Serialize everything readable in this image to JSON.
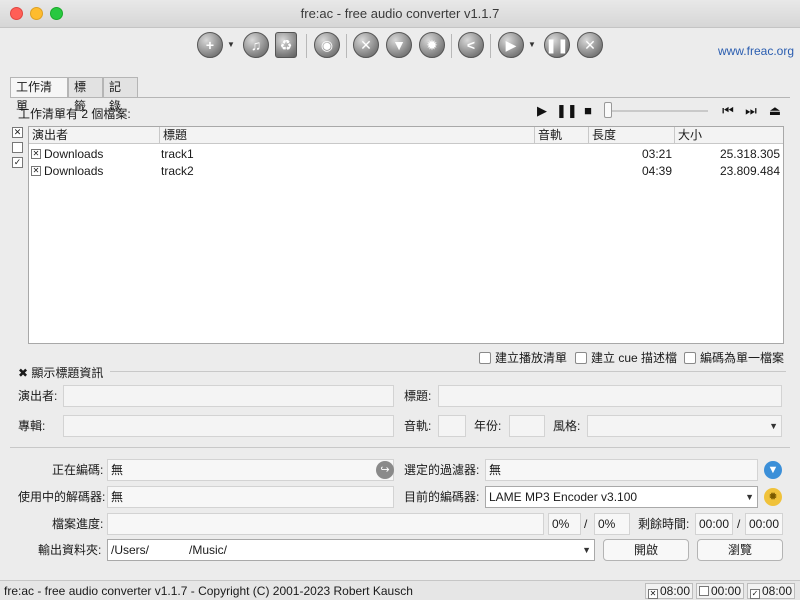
{
  "window": {
    "title": "fre:ac - free audio converter v1.1.7"
  },
  "toolbar": {
    "website": "www.freac.org"
  },
  "tabs": [
    "工作清單",
    "標籤",
    "記錄"
  ],
  "joblist": {
    "count_text": "工作清單有 2 個檔案:",
    "columns": {
      "artist": "演出者",
      "title": "標題",
      "track": "音軌",
      "length": "長度",
      "size": "大小"
    },
    "rows": [
      {
        "artist": "Downloads",
        "title": "track1",
        "length": "03:21",
        "size": "25.318.305"
      },
      {
        "artist": "Downloads",
        "title": "track2",
        "length": "04:39",
        "size": "23.809.484"
      }
    ]
  },
  "options": {
    "playlist": "建立播放清單",
    "cue": "建立 cue 描述檔",
    "single_file": "編碼為單一檔案"
  },
  "tag_info": {
    "section": "顯示標題資訊",
    "artist_label": "演出者:",
    "title_label": "標題:",
    "album_label": "專輯:",
    "track_label": "音軌:",
    "year_label": "年份:",
    "genre_label": "風格:"
  },
  "status_panel": {
    "encoding_label": "正在編碼:",
    "encoding_value": "無",
    "filter_label": "選定的過濾器:",
    "filter_value": "無",
    "decoder_label": "使用中的解碼器:",
    "decoder_value": "無",
    "encoder_label": "目前的編碼器:",
    "encoder_value": "LAME MP3 Encoder v3.100",
    "progress_label": "檔案進度:",
    "progress_file": "0%",
    "slash": "/",
    "progress_total": "0%",
    "remaining_label": "剩餘時間:",
    "time_a": "00:00",
    "time_b": "00:00",
    "output_label": "輸出資料夾:",
    "output_path": "/Users/            /Music/",
    "open_button": "開啟",
    "browse_button": "瀏覽"
  },
  "statusbar": {
    "text": "fre:ac - free audio converter v1.1.7 - Copyright (C) 2001-2023 Robert Kausch",
    "time1": "08:00",
    "time2": "00:00",
    "time3": "08:00"
  }
}
